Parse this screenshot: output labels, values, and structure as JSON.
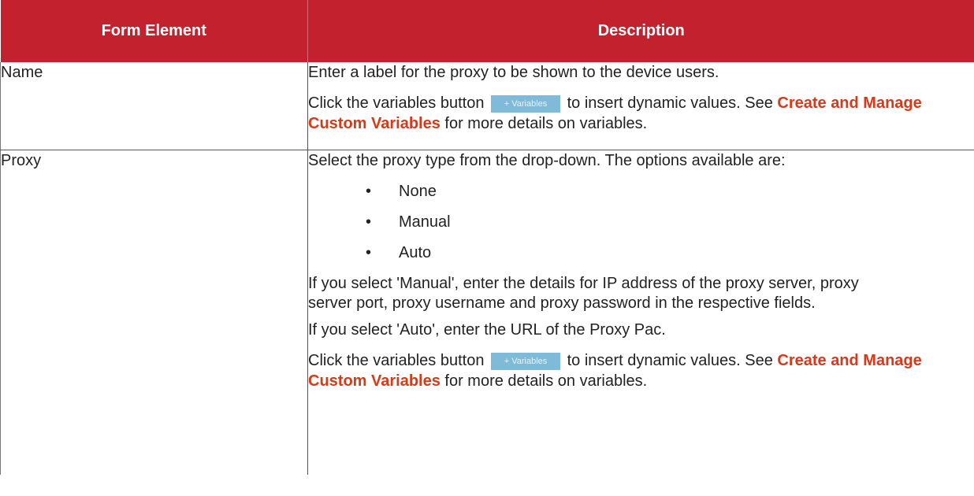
{
  "table": {
    "headers": {
      "form_element": "Form Element",
      "description": "Description"
    },
    "name_row": {
      "label": "Name",
      "line1": "Enter a label for the proxy to be shown to the device users.",
      "click_prefix": "Click the variables button",
      "variables_button": "+ Variables",
      "click_suffix": " to insert dynamic values. See ",
      "link_text": "Create and Manage Custom Variables",
      "after_link": " for more details on variables."
    },
    "proxy_row": {
      "label": "Proxy",
      "line1": "Select the proxy type from the drop-down. The options available are:",
      "options": [
        "None",
        "Manual",
        "Auto"
      ],
      "bullet": "•",
      "manual_line1": "If you select 'Manual', enter the details for IP address of the proxy server, proxy",
      "manual_line2": "server port, proxy username and proxy password in the respective fields.",
      "auto_text": "If you select 'Auto', enter the URL of the Proxy Pac.",
      "click_prefix": "Click the variables button",
      "variables_button": "+ Variables",
      "click_suffix": " to insert dynamic values. See ",
      "link_text": "Create and Manage Custom Variables",
      "after_link": " for more details on variables."
    }
  },
  "colors": {
    "header_bg": "#c4212e",
    "link": "#d43b1a",
    "variables_button": "#7fbad9"
  }
}
